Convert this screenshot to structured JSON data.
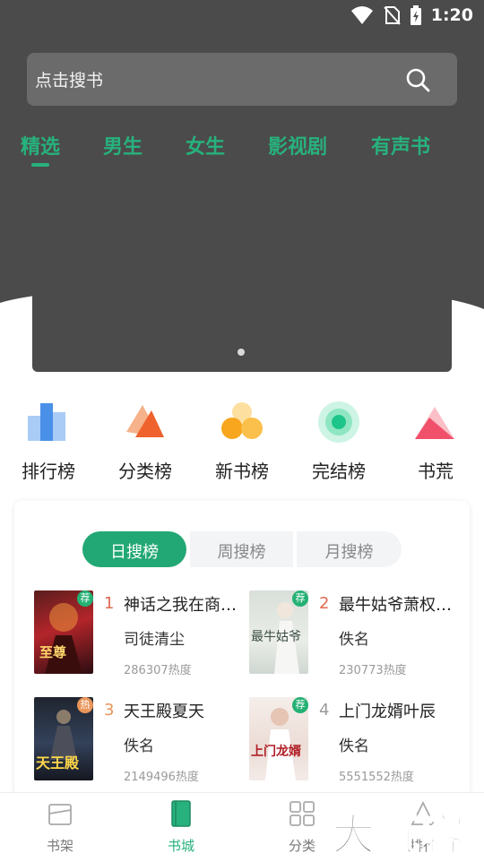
{
  "status": {
    "time": "1:20"
  },
  "search": {
    "placeholder": "点击搜书"
  },
  "tabs": [
    {
      "label": "精选",
      "active": true
    },
    {
      "label": "男生"
    },
    {
      "label": "女生"
    },
    {
      "label": "影视剧"
    },
    {
      "label": "有声书"
    }
  ],
  "quick": [
    {
      "label": "排行榜",
      "icon": "bar-chart-icon"
    },
    {
      "label": "分类榜",
      "icon": "category-icon"
    },
    {
      "label": "新书榜",
      "icon": "new-books-icon"
    },
    {
      "label": "完结榜",
      "icon": "finished-icon"
    },
    {
      "label": "书荒",
      "icon": "book-shortage-icon"
    }
  ],
  "ranking": {
    "segments": [
      {
        "label": "日搜榜",
        "active": true
      },
      {
        "label": "周搜榜"
      },
      {
        "label": "月搜榜"
      }
    ],
    "books": [
      {
        "rank": "1",
        "title": "神话之我在商朝…",
        "author": "司徒清尘",
        "heat": "286307热度",
        "badge": "荐"
      },
      {
        "rank": "2",
        "title": "最牛姑爷萧权秦…",
        "author": "佚名",
        "heat": "230773热度",
        "badge": "荐"
      },
      {
        "rank": "3",
        "title": "天王殿夏天",
        "author": "佚名",
        "heat": "2149496热度",
        "badge": "热"
      },
      {
        "rank": "4",
        "title": "上门龙婿叶辰",
        "author": "佚名",
        "heat": "5551552热度",
        "badge": "荐"
      }
    ],
    "cover_texts": [
      "至尊",
      "最牛姑爷",
      "天王殿",
      "上门龙婿"
    ]
  },
  "nav": [
    {
      "label": "书架"
    },
    {
      "label": "书城",
      "active": true
    },
    {
      "label": "分类"
    },
    {
      "label": "排行"
    }
  ],
  "watermark": "大玩客",
  "colors": {
    "accent": "#27b17d",
    "dark": "#4b4b4b",
    "rank_hot": "#e06a50",
    "rank_mid": "#e9955a",
    "rank_gray": "#9a9a9a"
  }
}
